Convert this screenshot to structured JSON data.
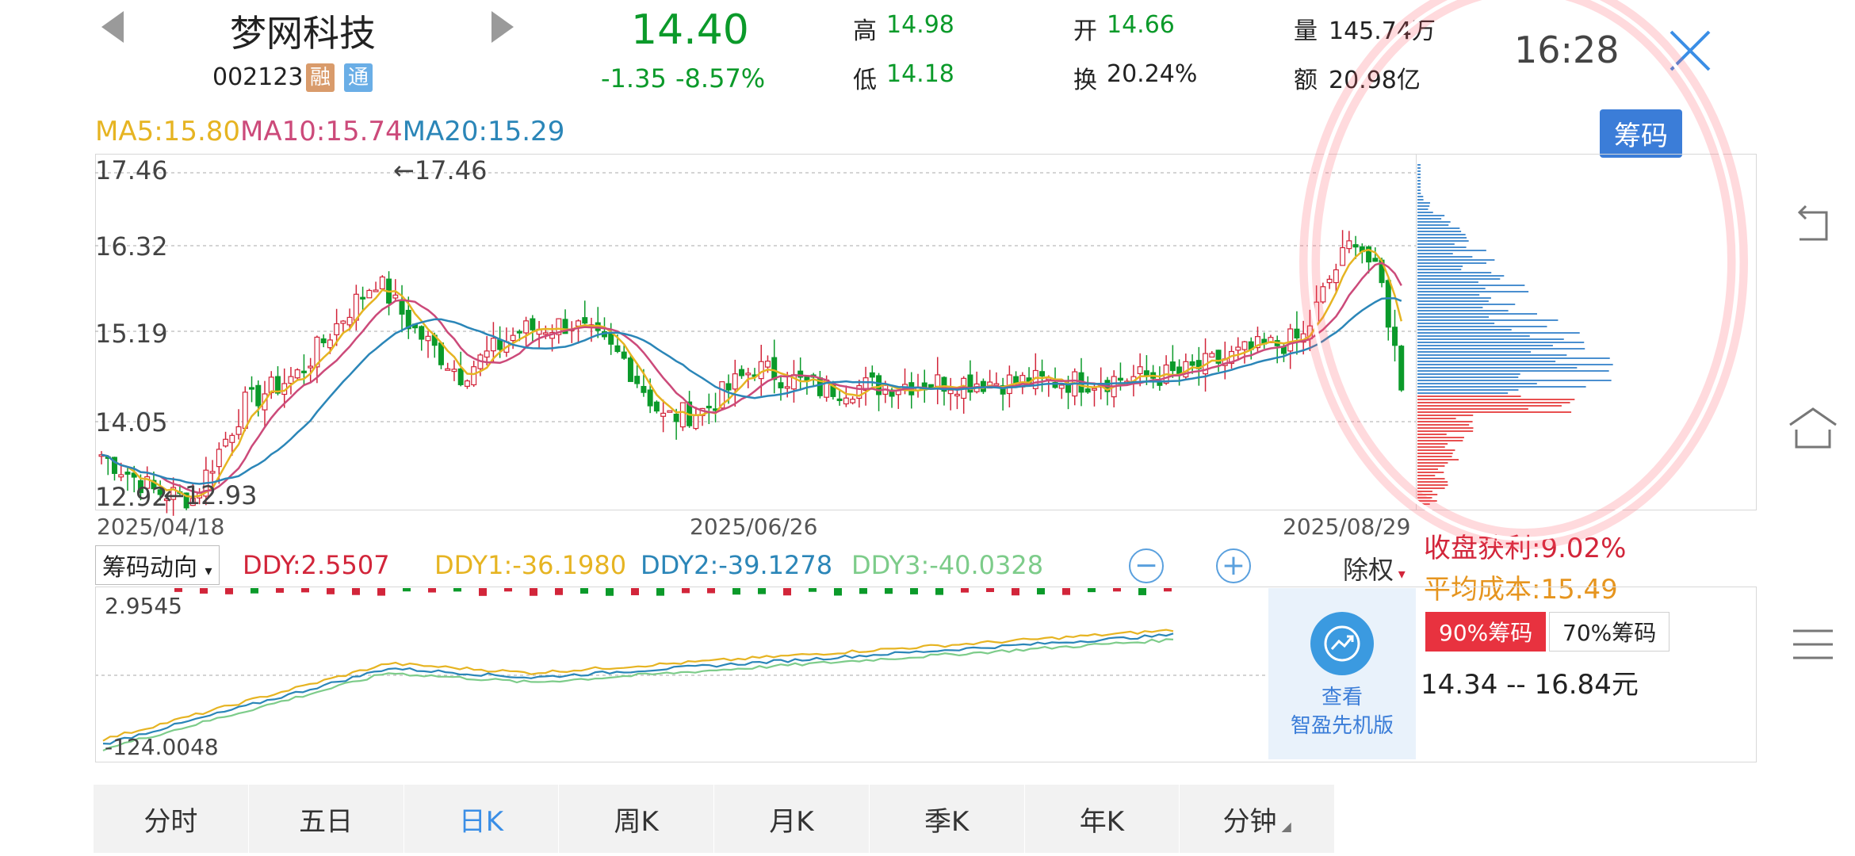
{
  "header": {
    "name": "梦网科技",
    "code": "002123",
    "tag_rong": "融",
    "tag_tong": "通",
    "price": "14.40",
    "change": "-1.35",
    "change_pct": "-8.57%",
    "high_label": "高",
    "high": "14.98",
    "low_label": "低",
    "low": "14.18",
    "open_label": "开",
    "open": "14.66",
    "turnover_label": "换",
    "turnover": "20.24%",
    "volume_label": "量",
    "volume": "145.74万",
    "amount_label": "额",
    "amount": "20.98亿",
    "time": "16:28"
  },
  "ma_legend": {
    "ma5": "MA5:15.80",
    "ma10": "MA10:15.74",
    "ma20": "MA20:15.29"
  },
  "chip_button": "筹码",
  "price_axis": [
    "17.46",
    "16.32",
    "15.19",
    "14.05",
    "12.92"
  ],
  "annotations": {
    "max": "←17.46",
    "min": "←12.93"
  },
  "dates": [
    "2025/04/18",
    "2025/06/26",
    "2025/08/29"
  ],
  "indicator": {
    "select_label": "筹码动向",
    "ddy": "DDY:2.5507",
    "ddy1": "DDY1:-36.1980",
    "ddy2": "DDY2:-39.1278",
    "ddy3": "DDY3:-40.0328",
    "minus": "−",
    "plus": "+",
    "rights_label": "除权",
    "axis_top": "2.9545",
    "axis_bottom": "-124.0048"
  },
  "promo": {
    "line1": "查看",
    "line2": "智盈先机版"
  },
  "chips": {
    "profit": "收盘获利:9.02%",
    "avg_cost": "平均成本:15.49",
    "btn90": "90%筹码",
    "btn70": "70%筹码",
    "range": "14.34 --  16.84元"
  },
  "tabs": [
    "分时",
    "五日",
    "日K",
    "周K",
    "月K",
    "季K",
    "年K",
    "分钟"
  ],
  "active_tab": "日K",
  "colors": {
    "up": "#d2253a",
    "down": "#0b9a2a",
    "ma5": "#e6b422",
    "ma10": "#cc4a7a",
    "ma20": "#2b86b8",
    "accent": "#3b7dd8"
  },
  "icons": [
    "back-arrow-icon",
    "forward-arrow-icon",
    "close-icon",
    "return-icon",
    "home-icon",
    "menu-icon",
    "trend-icon"
  ]
}
